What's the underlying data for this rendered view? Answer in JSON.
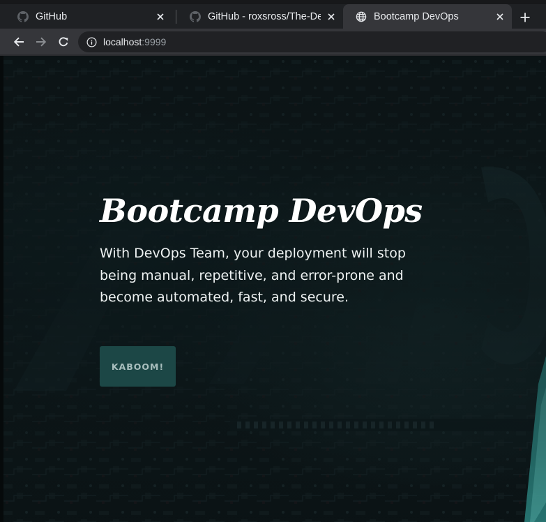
{
  "browser": {
    "tabs": [
      {
        "title": "GitHub",
        "icon": "github-icon",
        "active": false
      },
      {
        "title": "GitHub - roxsross/The-De",
        "icon": "github-icon",
        "active": false
      },
      {
        "title": "Bootcamp DevOps",
        "icon": "globe-icon",
        "active": true
      }
    ],
    "new_tab_label": "+",
    "address_bar": {
      "host": "localhost",
      "port": ":9999",
      "icon": "info-icon"
    },
    "colors": {
      "tabstrip": "#1f2124",
      "active_tab": "#35363a",
      "omnibox": "#202124"
    }
  },
  "page": {
    "hero": {
      "title": "Bootcamp DevOps",
      "description": "With DevOps Team, your deployment will stop being manual, repetitive, and error-prone and become automated, fast, and secure.",
      "button_label": "KABOOM!"
    },
    "colors": {
      "background": "#0f1a1c",
      "button": "#1c4746",
      "button_text": "#a9bfbe",
      "accent": "#3fa6a0"
    }
  }
}
